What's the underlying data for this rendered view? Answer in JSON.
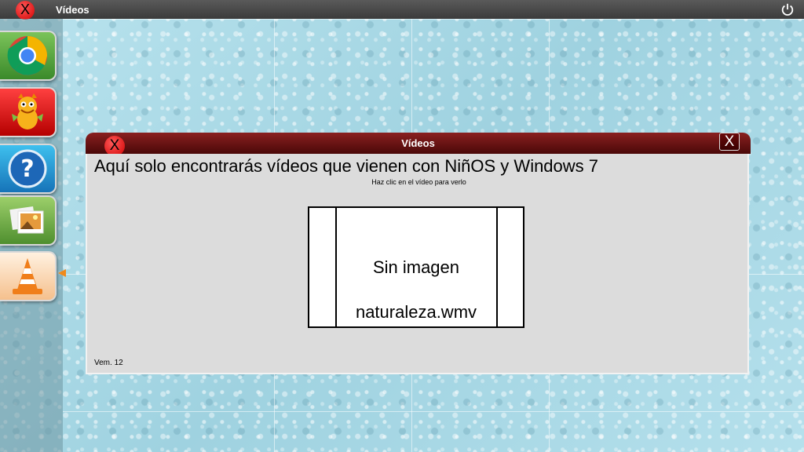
{
  "top_bar": {
    "title": "Vídeos",
    "badge_glyph": "X",
    "power_icon": "power-icon"
  },
  "dock": {
    "items": [
      {
        "name": "chrome",
        "icon": "chrome-icon"
      },
      {
        "name": "game",
        "icon": "dragon-icon"
      },
      {
        "name": "help",
        "icon": "help-icon"
      },
      {
        "name": "photos",
        "icon": "photos-icon"
      },
      {
        "name": "vlc",
        "icon": "vlc-cone-icon"
      }
    ]
  },
  "dialog": {
    "title": "Vídeos",
    "badge_glyph": "X",
    "close_label": "X",
    "heading": "Aquí solo encontrarás vídeos que vienen con NiñOS y Windows 7",
    "hint": "Haz clic en el vídeo para verlo",
    "video": {
      "no_image": "Sin imagen",
      "file_name": "naturaleza.wmv"
    },
    "version": "Vem. 12"
  },
  "colors": {
    "header": "#6a1010",
    "panel": "#dcdcdc",
    "background": "#a9d9e6"
  }
}
